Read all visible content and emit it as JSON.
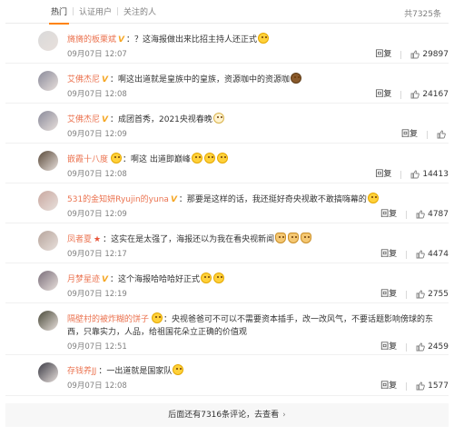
{
  "tabs": [
    "热门",
    "认证用户",
    "关注的人"
  ],
  "total": "共7325条",
  "comments": [
    {
      "user": "旖旖的板栗斌",
      "badge": "V",
      "text": "？这海报做出来比招主持人还正式",
      "emojis": [
        "laugh"
      ],
      "time": "09月07日 12:07",
      "reply": "回复",
      "likes": "29897",
      "avatar_color": "#d9d9d9"
    },
    {
      "user": "艾佛杰尼",
      "badge": "V",
      "text": "啊这出道就是皇族中的皇族，资源咖中的资源咖",
      "emojis": [
        "brown"
      ],
      "time": "09月07日 12:08",
      "reply": "回复",
      "likes": "24167",
      "avatar_color": "#8a8a9a"
    },
    {
      "user": "艾佛杰尼",
      "badge": "V",
      "text": "成团首秀，2021央视春晚",
      "emojis": [
        "cat"
      ],
      "time": "09月07日 12:09",
      "reply": "回复",
      "likes": "",
      "avatar_color": "#8a8a9a"
    },
    {
      "user": "嵌霞十八度",
      "badge": "emoji",
      "text": "啊这 出道即巅峰",
      "emojis": [
        "laugh",
        "laugh",
        "laugh"
      ],
      "time": "09月07日 12:08",
      "reply": "回复",
      "likes": "14413",
      "avatar_color": "#5a4a3a"
    },
    {
      "user": "531的金知妍Ryujin的yuna",
      "badge": "V",
      "text": "那要是这样的话，我还挺好奇央视敢不敢搞嗨幕的",
      "emojis": [
        "laugh"
      ],
      "time": "09月07日 12:09",
      "reply": "回复",
      "likes": "4787",
      "avatar_color": "#c9a8a0"
    },
    {
      "user": "凤者夏",
      "badge": "star",
      "text": "这实在是太强了，海报还以为我在看央视新闻",
      "emojis": [
        "clap",
        "clap",
        "clap"
      ],
      "time": "09月07日 12:17",
      "reply": "回复",
      "likes": "4474",
      "avatar_color": "#b7a59c"
    },
    {
      "user": "月梦星迹",
      "badge": "V",
      "text": "这个海报哈哈哈好正式",
      "emojis": [
        "laugh",
        "laugh"
      ],
      "time": "09月07日 12:19",
      "reply": "回复",
      "likes": "2755",
      "avatar_color": "#7a6e7a"
    },
    {
      "user": "隔壁村的被炸糊的饼子",
      "badge": "emoji",
      "text": "央视爸爸可不可以不需要资本插手，改一改风气，不要话题影响傍球的东西，只靠实力，人品，给祖国花朵立正确的价值观",
      "emojis": [],
      "time": "09月07日 12:51",
      "reply": "回复",
      "likes": "2459",
      "avatar_color": "#4a4a3a"
    },
    {
      "user": "存钱养JJ",
      "badge": "",
      "text": "一出道就是国家队",
      "emojis": [
        "laugh"
      ],
      "time": "09月07日 12:08",
      "reply": "回复",
      "likes": "1577",
      "avatar_color": "#3a3a44"
    }
  ],
  "more_text": "后面还有7316条评论，去查看",
  "more_chev": "›",
  "accent": "#ff8200",
  "username_color": "#eb7350"
}
